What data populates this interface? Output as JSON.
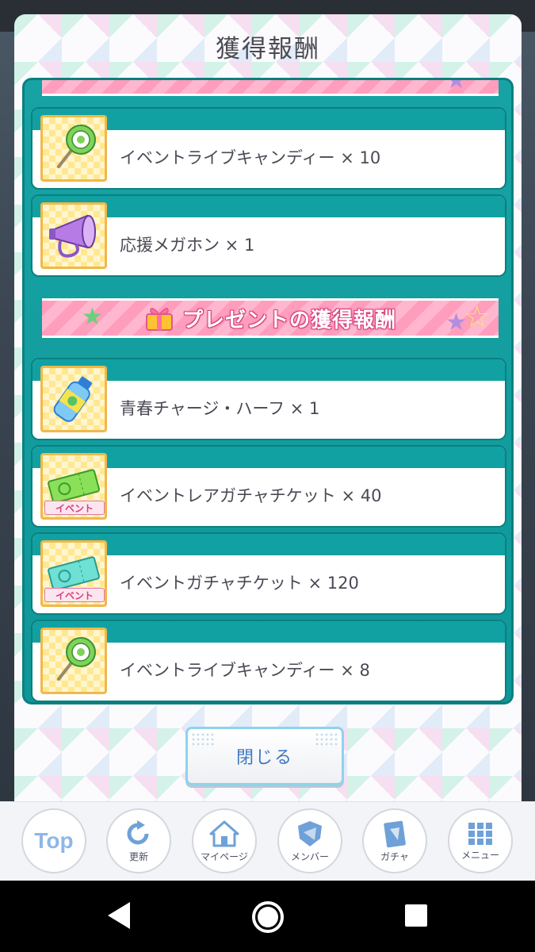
{
  "dialog": {
    "title": "獲得報酬",
    "section_present": "プレゼントの獲得報酬",
    "close_label": "閉じる",
    "items_group1": [
      {
        "label": "イベントライブキャンディー × 10",
        "icon": "candy-icon"
      },
      {
        "label": "応援メガホン × 1",
        "icon": "megaphone-icon"
      }
    ],
    "items_group2": [
      {
        "label": "青春チャージ・ハーフ × 1",
        "icon": "drink-bottle-icon"
      },
      {
        "label": "イベントレアガチャチケット × 40",
        "icon": "rare-ticket-icon",
        "tag": "イベント"
      },
      {
        "label": "イベントガチャチケット × 120",
        "icon": "ticket-icon",
        "tag": "イベント"
      },
      {
        "label": "イベントライブキャンディー × 8",
        "icon": "candy-icon"
      }
    ]
  },
  "nav": {
    "top": "Top",
    "refresh": "更新",
    "mypage": "マイページ",
    "member": "メンバー",
    "gacha": "ガチャ",
    "menu": "メニュー"
  },
  "colors": {
    "panel_teal": "#17a3a4",
    "ribbon_pink": "#ff9dbd",
    "button_text": "#3f78c4"
  }
}
